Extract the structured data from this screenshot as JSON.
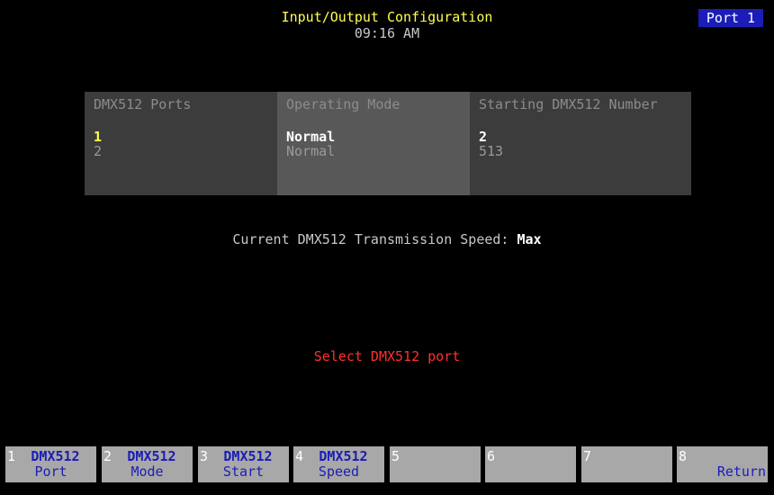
{
  "header": {
    "title": "Input/Output Configuration",
    "time": "09:16 AM",
    "port_badge": "Port 1"
  },
  "table": {
    "columns": [
      "DMX512 Ports",
      "Operating Mode",
      "Starting DMX512 Number"
    ],
    "rows": [
      {
        "port": "1",
        "mode": "Normal",
        "start": "2"
      },
      {
        "port": "2",
        "mode": "Normal",
        "start": "513"
      }
    ],
    "selected_row": 0
  },
  "speed": {
    "label": "Current DMX512 Transmission Speed:",
    "value": "Max"
  },
  "prompt": "Select DMX512 port",
  "softkeys": [
    {
      "num": "1",
      "line1": "DMX512",
      "line2": "Port"
    },
    {
      "num": "2",
      "line1": "DMX512",
      "line2": "Mode"
    },
    {
      "num": "3",
      "line1": "DMX512",
      "line2": "Start"
    },
    {
      "num": "4",
      "line1": "DMX512",
      "line2": "Speed"
    },
    {
      "num": "5",
      "line1": "",
      "line2": ""
    },
    {
      "num": "6",
      "line1": "",
      "line2": ""
    },
    {
      "num": "7",
      "line1": "",
      "line2": ""
    },
    {
      "num": "8",
      "line1": "",
      "line2": "Return"
    }
  ],
  "colors": {
    "background": "#000000",
    "title": "#ffff54",
    "badge": "#1c1cb8",
    "prompt": "#ff3030",
    "softkey": "#a8a8a8",
    "softkey_text": "#1c1cb8"
  }
}
